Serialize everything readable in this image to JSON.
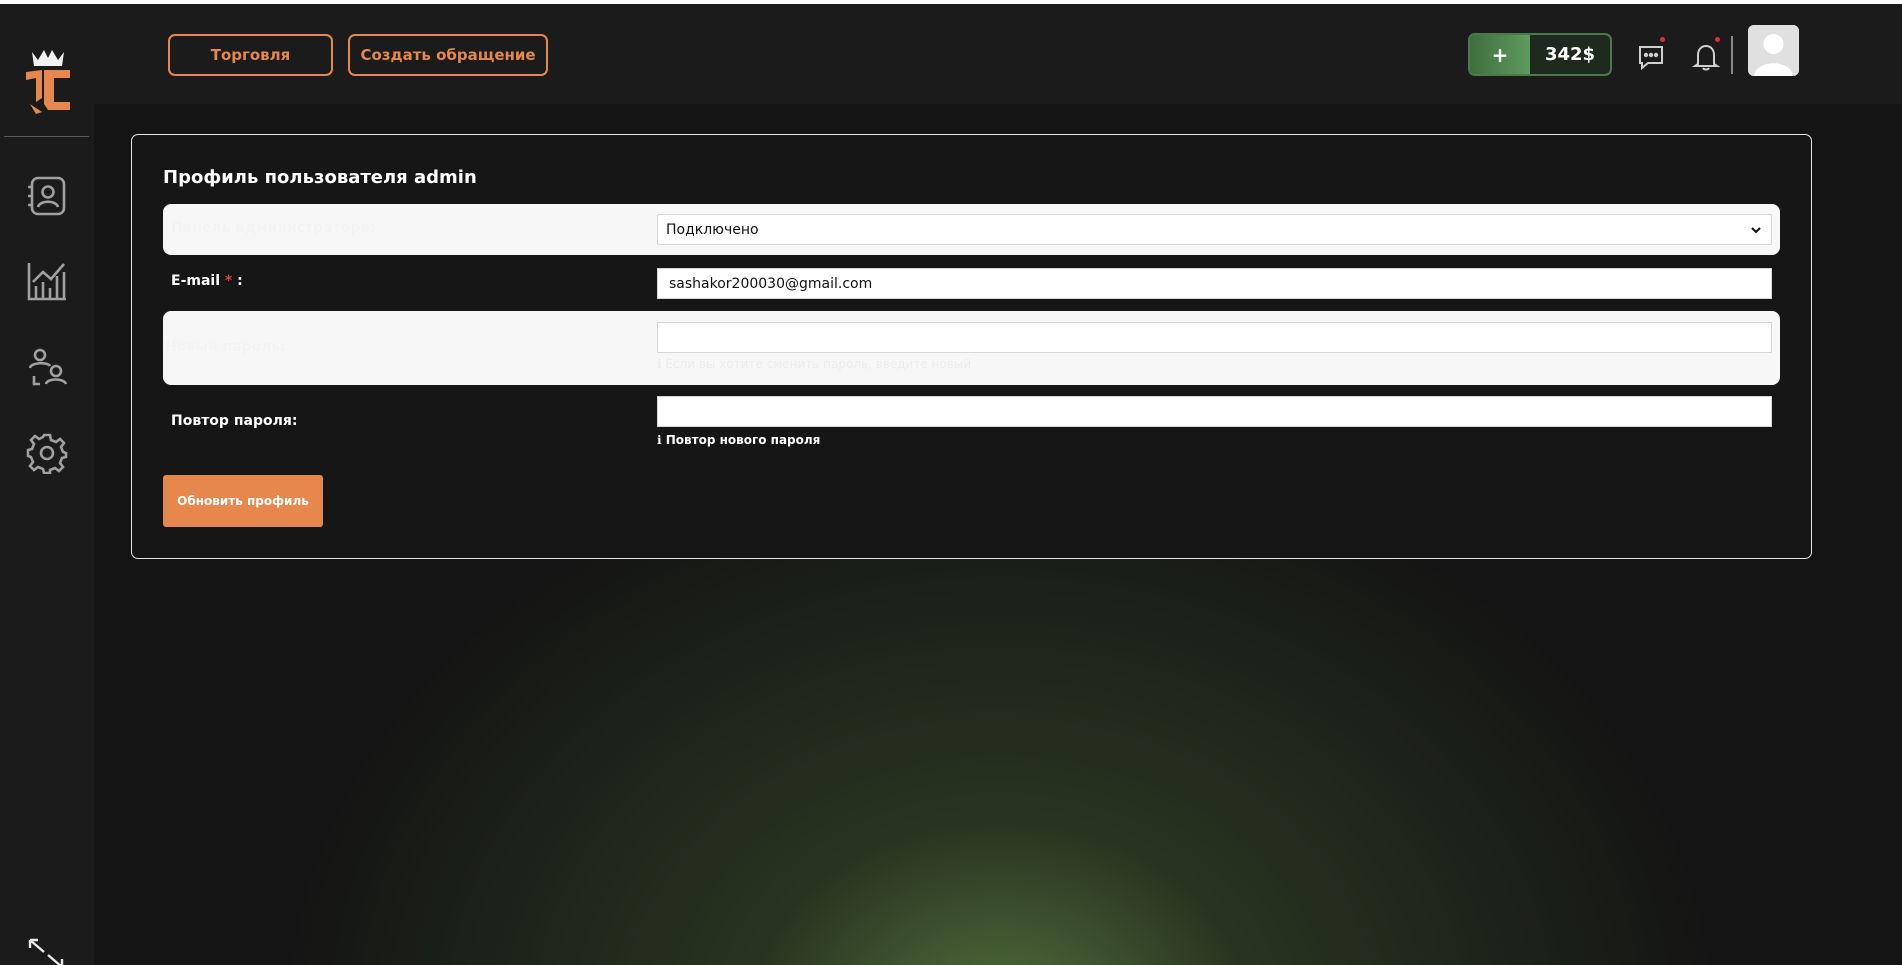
{
  "header": {
    "trade_button": "Торговля",
    "create_request_button": "Создать обращение",
    "balance_plus": "+",
    "balance_value": "342$"
  },
  "profile": {
    "title": "Профиль пользователя admin",
    "admin_panel": {
      "label": "Панель администратора:",
      "selected_value": "Подключено"
    },
    "email": {
      "label": "E-mail",
      "required_mark": "*",
      "colon": ":",
      "value": "sashakor200030@gmail.com"
    },
    "new_password": {
      "label": "Новый пароль:",
      "value": "",
      "hint": "Если вы хотите сменить пароль, введите новый"
    },
    "repeat_password": {
      "label": "Повтор пароля:",
      "value": "",
      "hint": "Повтор нового пароля"
    },
    "submit_button": "Обновить профиль"
  },
  "colors": {
    "accent": "#e6874d",
    "balance_green": "#4c7a4c",
    "notification_dot": "#e03030",
    "background": "#141414"
  },
  "icons": {
    "sidebar": [
      "contacts-icon",
      "chart-icon",
      "users-icon",
      "gear-icon"
    ],
    "header": [
      "chat-icon",
      "bell-icon"
    ],
    "bottom": "expand-icon"
  }
}
